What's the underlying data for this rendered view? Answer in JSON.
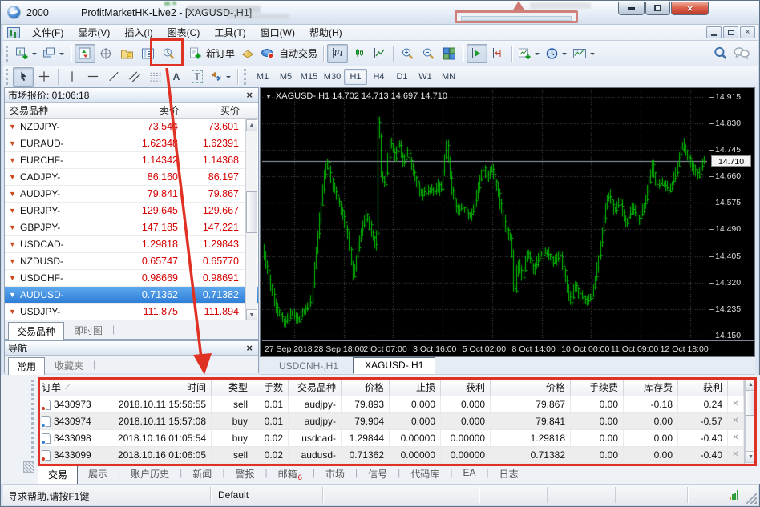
{
  "window": {
    "brand": "2000",
    "title": "ProfitMarketHK-Live2 - [XAGUSD-,H1]"
  },
  "menu": {
    "items": [
      "文件(F)",
      "显示(V)",
      "插入(I)",
      "图表(C)",
      "工具(T)",
      "窗口(W)",
      "帮助(H)"
    ]
  },
  "toolbar": {
    "new_order": "新订单",
    "autotrading": "自动交易",
    "timeframes": [
      "M1",
      "M5",
      "M15",
      "M30",
      "H1",
      "H4",
      "D1",
      "W1",
      "MN"
    ],
    "active_timeframe": "H1",
    "text_tool": "A",
    "label_tool": "T"
  },
  "market_watch": {
    "title": "市场报价: 01:06:18",
    "columns": {
      "symbol": "交易品种",
      "bid": "卖价",
      "ask": "买价"
    },
    "rows": [
      {
        "symbol": "NZDJPY-",
        "bid": "73.544",
        "ask": "73.601",
        "selected": false
      },
      {
        "symbol": "EURAUD-",
        "bid": "1.62348",
        "ask": "1.62391",
        "selected": false
      },
      {
        "symbol": "EURCHF-",
        "bid": "1.14342",
        "ask": "1.14368",
        "selected": false
      },
      {
        "symbol": "CADJPY-",
        "bid": "86.160",
        "ask": "86.197",
        "selected": false
      },
      {
        "symbol": "AUDJPY-",
        "bid": "79.841",
        "ask": "79.867",
        "selected": false
      },
      {
        "symbol": "EURJPY-",
        "bid": "129.645",
        "ask": "129.667",
        "selected": false
      },
      {
        "symbol": "GBPJPY-",
        "bid": "147.185",
        "ask": "147.221",
        "selected": false
      },
      {
        "symbol": "USDCAD-",
        "bid": "1.29818",
        "ask": "1.29843",
        "selected": false
      },
      {
        "symbol": "NZDUSD-",
        "bid": "0.65747",
        "ask": "0.65770",
        "selected": false
      },
      {
        "symbol": "USDCHF-",
        "bid": "0.98669",
        "ask": "0.98691",
        "selected": false
      },
      {
        "symbol": "AUDUSD-",
        "bid": "0.71362",
        "ask": "0.71382",
        "selected": true
      },
      {
        "symbol": "USDJPY-",
        "bid": "111.875",
        "ask": "111.894",
        "selected": false
      }
    ],
    "tabs": [
      "交易品种",
      "即时图"
    ],
    "active_tab": "交易品种"
  },
  "navigator": {
    "title": "导航",
    "tabs": [
      "常用",
      "收藏夹"
    ],
    "active_tab": "常用"
  },
  "chart": {
    "header": "XAGUSD-,H1  14.702 14.713 14.697 14.710",
    "current_price": "14.710",
    "price_ticks": [
      "14.915",
      "14.830",
      "14.745",
      "14.660",
      "14.575",
      "14.490",
      "14.405",
      "14.320",
      "14.235",
      "14.150"
    ],
    "time_ticks": [
      "27 Sep 2018",
      "28 Sep 18:00",
      "2 Oct 07:00",
      "3 Oct 16:00",
      "5 Oct 02:00",
      "8 Oct 14:00",
      "10 Oct 00:00",
      "11 Oct 09:00",
      "12 Oct 18:00"
    ],
    "tabs": [
      "USDCNH-,H1",
      "XAGUSD-,H1"
    ],
    "active_tab": "XAGUSD-,H1"
  },
  "chart_data": {
    "type": "bar",
    "symbol": "XAGUSD-",
    "timeframe": "H1",
    "title": "XAGUSD-,H1",
    "ohlc_header": {
      "open": 14.702,
      "high": 14.713,
      "low": 14.697,
      "close": 14.71
    },
    "current_price": 14.71,
    "ylim": [
      14.142,
      14.938
    ],
    "grid": true,
    "bars": 264,
    "bar_color": "#00c400",
    "price_keypoints": [
      [
        0,
        14.43
      ],
      [
        0.012,
        14.35
      ],
      [
        0.03,
        14.24
      ],
      [
        0.05,
        14.19
      ],
      [
        0.065,
        14.22
      ],
      [
        0.08,
        14.2
      ],
      [
        0.095,
        14.23
      ],
      [
        0.11,
        14.26
      ],
      [
        0.125,
        14.47
      ],
      [
        0.14,
        14.66
      ],
      [
        0.148,
        14.71
      ],
      [
        0.16,
        14.62
      ],
      [
        0.17,
        14.59
      ],
      [
        0.18,
        14.55
      ],
      [
        0.195,
        14.46
      ],
      [
        0.205,
        14.34
      ],
      [
        0.22,
        14.46
      ],
      [
        0.235,
        14.54
      ],
      [
        0.25,
        14.47
      ],
      [
        0.258,
        14.42
      ],
      [
        0.263,
        14.9
      ],
      [
        0.27,
        14.66
      ],
      [
        0.278,
        14.63
      ],
      [
        0.29,
        14.78
      ],
      [
        0.3,
        14.72
      ],
      [
        0.31,
        14.77
      ],
      [
        0.32,
        14.7
      ],
      [
        0.33,
        14.74
      ],
      [
        0.345,
        14.66
      ],
      [
        0.36,
        14.6
      ],
      [
        0.375,
        14.62
      ],
      [
        0.39,
        14.61
      ],
      [
        0.4,
        14.64
      ],
      [
        0.405,
        14.6
      ],
      [
        0.418,
        14.77
      ],
      [
        0.428,
        14.63
      ],
      [
        0.44,
        14.55
      ],
      [
        0.455,
        14.56
      ],
      [
        0.47,
        14.53
      ],
      [
        0.483,
        14.58
      ],
      [
        0.5,
        14.69
      ],
      [
        0.51,
        14.66
      ],
      [
        0.52,
        14.69
      ],
      [
        0.535,
        14.61
      ],
      [
        0.55,
        14.5
      ],
      [
        0.565,
        14.45
      ],
      [
        0.572,
        14.26
      ],
      [
        0.58,
        14.39
      ],
      [
        0.59,
        14.34
      ],
      [
        0.6,
        14.42
      ],
      [
        0.615,
        14.36
      ],
      [
        0.63,
        14.41
      ],
      [
        0.645,
        14.42
      ],
      [
        0.66,
        14.38
      ],
      [
        0.675,
        14.41
      ],
      [
        0.69,
        14.32
      ],
      [
        0.7,
        14.25
      ],
      [
        0.71,
        14.32
      ],
      [
        0.72,
        14.28
      ],
      [
        0.735,
        14.26
      ],
      [
        0.75,
        14.28
      ],
      [
        0.762,
        14.38
      ],
      [
        0.775,
        14.52
      ],
      [
        0.785,
        14.61
      ],
      [
        0.8,
        14.55
      ],
      [
        0.812,
        14.58
      ],
      [
        0.825,
        14.51
      ],
      [
        0.84,
        14.56
      ],
      [
        0.855,
        14.52
      ],
      [
        0.87,
        14.58
      ],
      [
        0.885,
        14.7
      ],
      [
        0.895,
        14.63
      ],
      [
        0.91,
        14.64
      ],
      [
        0.925,
        14.61
      ],
      [
        0.94,
        14.68
      ],
      [
        0.953,
        14.77
      ],
      [
        0.965,
        14.73
      ],
      [
        0.978,
        14.69
      ],
      [
        0.99,
        14.66
      ],
      [
        1,
        14.71
      ]
    ]
  },
  "terminal": {
    "columns": [
      "订单",
      "时间",
      "类型",
      "手数",
      "交易品种",
      "价格",
      "止损",
      "获利",
      "价格",
      "手续费",
      "库存费",
      "获利"
    ],
    "orders": [
      {
        "id": "3430973",
        "time": "2018.10.11 15:56:55",
        "type": "sell",
        "lots": "0.01",
        "symbol": "audjpy-",
        "price": "79.893",
        "sl": "0.000",
        "tp": "0.000",
        "price2": "79.867",
        "commission": "0.00",
        "swap": "-0.18",
        "profit": "0.24"
      },
      {
        "id": "3430974",
        "time": "2018.10.11 15:57:08",
        "type": "buy",
        "lots": "0.01",
        "symbol": "audjpy-",
        "price": "79.904",
        "sl": "0.000",
        "tp": "0.000",
        "price2": "79.841",
        "commission": "0.00",
        "swap": "0.00",
        "profit": "-0.57"
      },
      {
        "id": "3433098",
        "time": "2018.10.16 01:05:54",
        "type": "buy",
        "lots": "0.02",
        "symbol": "usdcad-",
        "price": "1.29844",
        "sl": "0.00000",
        "tp": "0.00000",
        "price2": "1.29818",
        "commission": "0.00",
        "swap": "0.00",
        "profit": "-0.40"
      },
      {
        "id": "3433099",
        "time": "2018.10.16 01:06:05",
        "type": "sell",
        "lots": "0.02",
        "symbol": "audusd-",
        "price": "0.71362",
        "sl": "0.00000",
        "tp": "0.00000",
        "price2": "0.71382",
        "commission": "0.00",
        "swap": "0.00",
        "profit": "-0.40"
      }
    ],
    "tabs": [
      "交易",
      "展示",
      "账户历史",
      "新闻",
      "警报",
      "邮箱",
      "市场",
      "信号",
      "代码库",
      "EA",
      "日志"
    ],
    "active_tab": "交易",
    "mail_badge": "6"
  },
  "status": {
    "help": "寻求帮助,请按F1键",
    "profile": "Default"
  },
  "colors": {
    "annotation_red": "#e03224",
    "price_red": "#d40000",
    "selection_blue": "#2f7fd8",
    "bar_green": "#00c400"
  }
}
